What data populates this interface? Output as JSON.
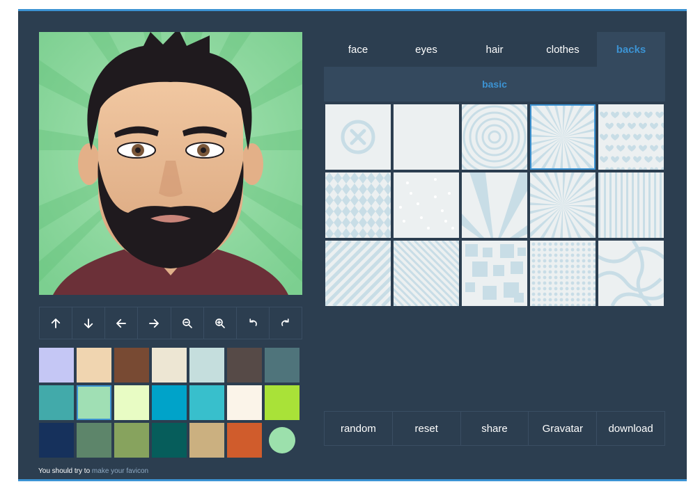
{
  "tabs": [
    {
      "label": "face"
    },
    {
      "label": "eyes"
    },
    {
      "label": "hair"
    },
    {
      "label": "clothes"
    },
    {
      "label": "backs",
      "active": true
    }
  ],
  "subtab": {
    "label": "basic"
  },
  "toolbar": [
    "arrow-up-icon",
    "arrow-down-icon",
    "arrow-left-icon",
    "arrow-right-icon",
    "zoom-out-icon",
    "zoom-in-icon",
    "undo-icon",
    "redo-icon"
  ],
  "palette": {
    "colors": [
      "#c5c7f5",
      "#f0d5b0",
      "#784a33",
      "#ede6d3",
      "#c5dedd",
      "#564a47",
      "#4f747b",
      "#42aaaa",
      "#a0dfb4",
      "#e8fcc4",
      "#00a3c9",
      "#38bfcc",
      "#fbf4e9",
      "#a9e238",
      "#16315c",
      "#5d856a",
      "#87a35e",
      "#065d5b",
      "#cbb080",
      "#d05c2c",
      "#9ce0ac"
    ],
    "selected_index": 8,
    "last_is_circle": true
  },
  "backgrounds": {
    "patterns": [
      "none",
      "plain",
      "circles",
      "sunburst",
      "hearts",
      "diamonds",
      "dots",
      "rays",
      "starburst",
      "vstripes",
      "diag-right",
      "diag-left",
      "squares",
      "dot-grid",
      "waves"
    ],
    "selected_index": 3
  },
  "actions": {
    "random": "random",
    "reset": "reset",
    "share": "share",
    "gravatar": "Gravatar",
    "download": "download"
  },
  "footer": {
    "text": "You should try to",
    "link": "make your favicon"
  },
  "colors": {
    "panel": "#2c3e50",
    "accent": "#3c93d3",
    "active_tab": "#34495e",
    "avatar_bg": "#8fd9a0"
  }
}
